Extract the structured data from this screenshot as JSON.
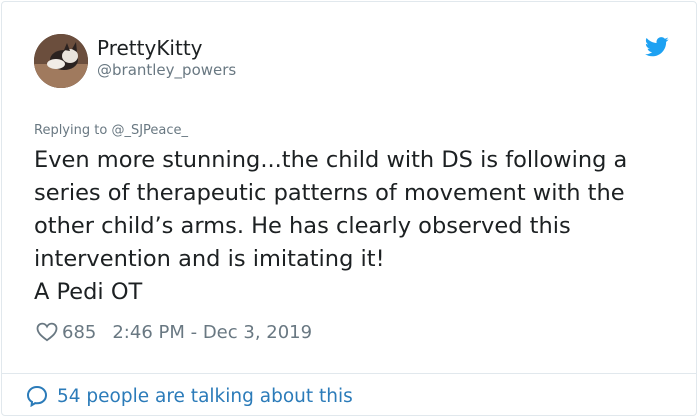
{
  "author": {
    "display_name": "PrettyKitty",
    "handle": "@brantley_powers",
    "avatar_icon": "cat-avatar"
  },
  "brand": {
    "icon": "twitter-bird-icon",
    "color": "#1da1f2"
  },
  "reply": {
    "prefix": "Replying to",
    "target": "@_SJPeace_"
  },
  "tweet": {
    "line1": "Even more stunning...the child with DS is following a series of therapeutic patterns of movement with the other child’s arms. He has clearly observed this intervention and is imitating it!",
    "line2": "A Pedi OT"
  },
  "meta": {
    "likes": "685",
    "timestamp": "2:46 PM - Dec 3, 2019"
  },
  "footer": {
    "conversation_label": "54 people are talking about this",
    "link_color": "#2b7bb9"
  }
}
